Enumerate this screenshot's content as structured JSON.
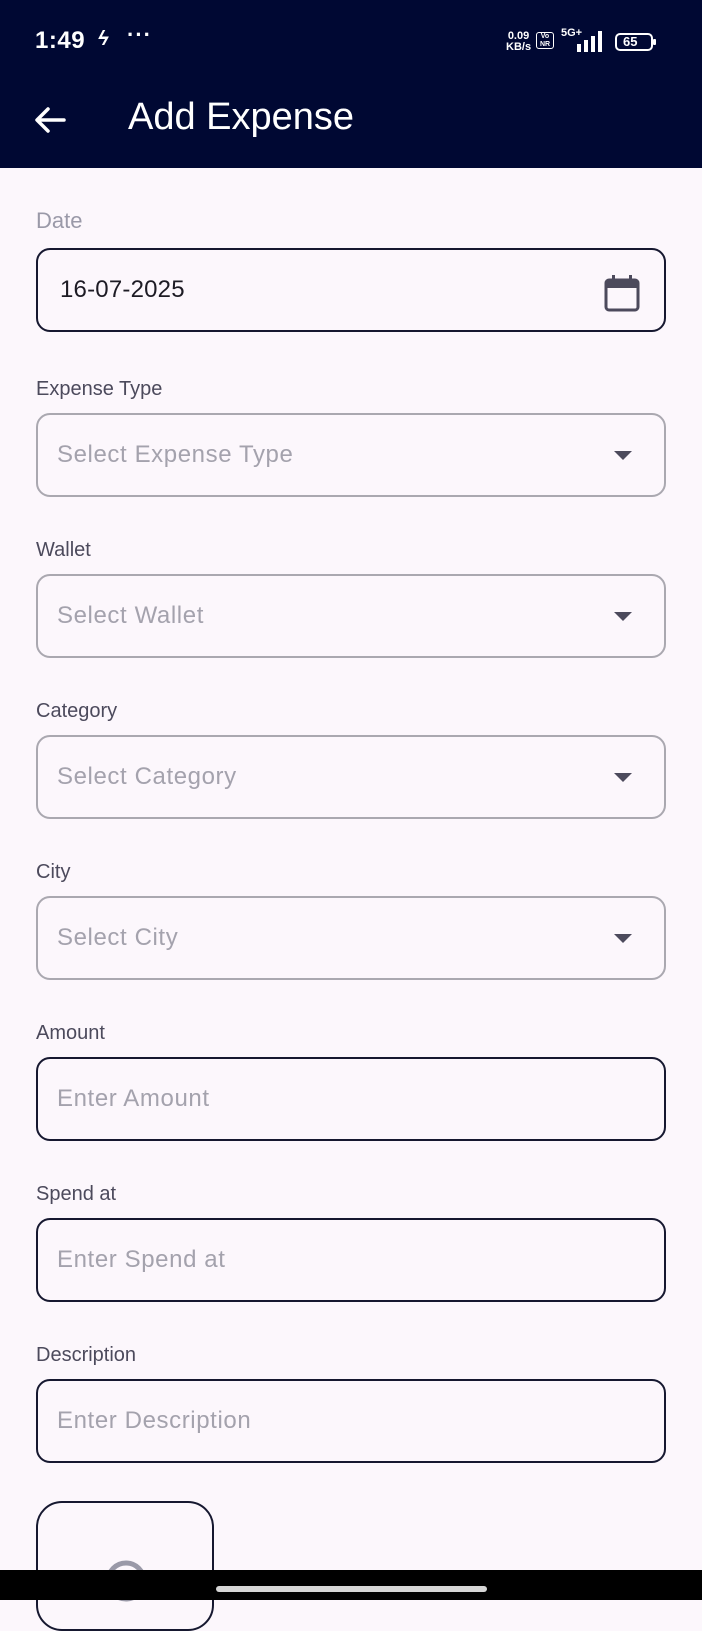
{
  "status_bar": {
    "time": "1:49",
    "flash_glyph": "ϟ",
    "more_dots": "···",
    "speed_value": "0.09",
    "speed_unit": "KB/s",
    "volte": "Vo NR",
    "network": "5G+",
    "battery_level": "65"
  },
  "app_bar": {
    "title": "Add Expense",
    "back_icon": "arrow-left-icon"
  },
  "form": {
    "date": {
      "label": "Date",
      "value": "16-07-2025",
      "icon": "calendar-icon"
    },
    "expense_type": {
      "label": "Expense Type",
      "placeholder": "Select Expense Type"
    },
    "wallet": {
      "label": "Wallet",
      "placeholder": "Select Wallet"
    },
    "category": {
      "label": "Category",
      "placeholder": "Select Category"
    },
    "city": {
      "label": "City",
      "placeholder": "Select City"
    },
    "amount": {
      "label": "Amount",
      "placeholder": "Enter Amount"
    },
    "spend_at": {
      "label": "Spend at",
      "placeholder": "Enter Spend at"
    },
    "description": {
      "label": "Description",
      "placeholder": "Enter Description"
    },
    "image_picker": {
      "icon": "image-icon"
    }
  },
  "colors": {
    "app_bar": "#000833",
    "background": "#fcf7fc",
    "field_border_dark": "#161830",
    "field_border_light": "#aaa8b0"
  }
}
